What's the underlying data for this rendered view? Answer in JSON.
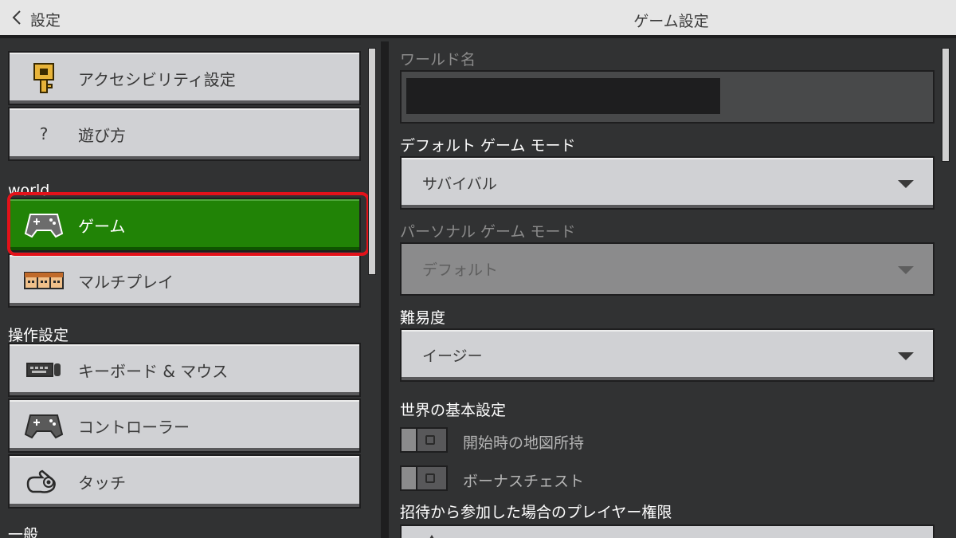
{
  "header": {
    "back_label": "設定",
    "title": "ゲーム設定"
  },
  "sidebar": {
    "items_top": [
      {
        "label": "アクセシビリティ設定",
        "icon": "key-icon"
      },
      {
        "label": "遊び方",
        "icon": "question-icon"
      }
    ],
    "section_world": "world",
    "items_world": [
      {
        "label": "ゲーム",
        "icon": "controller-icon",
        "active": true
      },
      {
        "label": "マルチプレイ",
        "icon": "players-icon"
      }
    ],
    "section_controls": "操作設定",
    "items_controls": [
      {
        "label": "キーボード & マウス",
        "icon": "keyboard-mouse-icon"
      },
      {
        "label": "コントローラー",
        "icon": "controller-icon"
      },
      {
        "label": "タッチ",
        "icon": "touch-icon"
      }
    ],
    "section_general": "一般"
  },
  "settings": {
    "world_name_label": "ワールド名",
    "world_name_value": "",
    "default_mode_label": "デフォルト ゲーム モード",
    "default_mode_value": "サバイバル",
    "personal_mode_label": "パーソナル ゲーム モード",
    "personal_mode_value": "デフォルト",
    "difficulty_label": "難易度",
    "difficulty_value": "イージー",
    "world_prefs_label": "世界の基本設定",
    "toggle_map_label": "開始時の地図所持",
    "toggle_map_value": false,
    "toggle_chest_label": "ボーナスチェスト",
    "toggle_chest_value": false,
    "invite_perm_label": "招待から参加した場合のプレイヤー権限"
  },
  "colors": {
    "accent_green": "#218306",
    "selection_red": "#e3121a",
    "background": "#313233"
  }
}
